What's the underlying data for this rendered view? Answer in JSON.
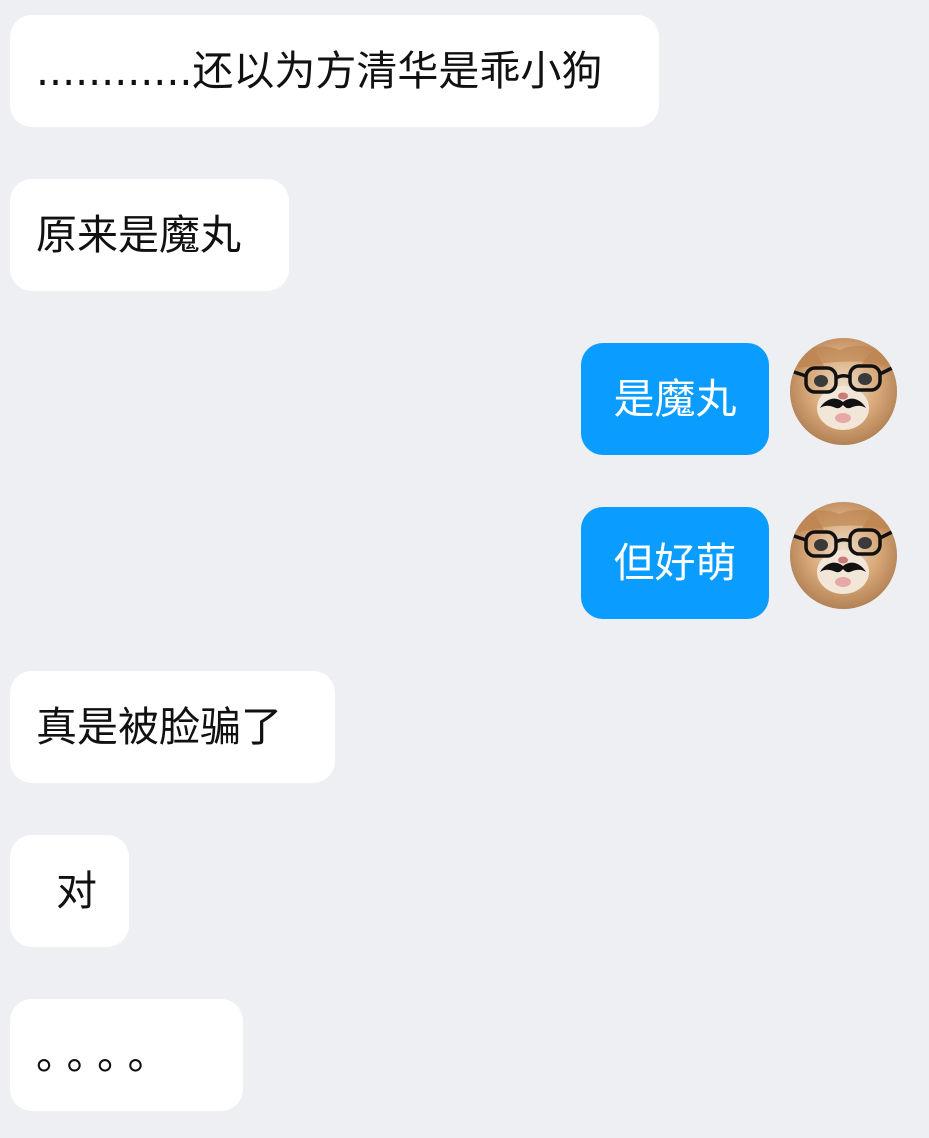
{
  "messages": [
    {
      "side": "incoming",
      "text": "............还以为方清华是乖小狗"
    },
    {
      "side": "incoming",
      "text": "原来是魔丸"
    },
    {
      "side": "outgoing",
      "text": "是魔丸"
    },
    {
      "side": "outgoing",
      "text": "但好萌"
    },
    {
      "side": "incoming",
      "text": "真是被脸骗了"
    },
    {
      "side": "incoming",
      "text": "对"
    },
    {
      "side": "incoming",
      "text": "。。。。"
    }
  ],
  "avatar": {
    "icon": "cat-with-glasses-and-mustache-icon"
  },
  "colors": {
    "background": "#eeeff2",
    "incoming_bubble": "#ffffff",
    "outgoing_bubble": "#0a9cff",
    "incoming_text": "#111111",
    "outgoing_text": "#ffffff"
  }
}
